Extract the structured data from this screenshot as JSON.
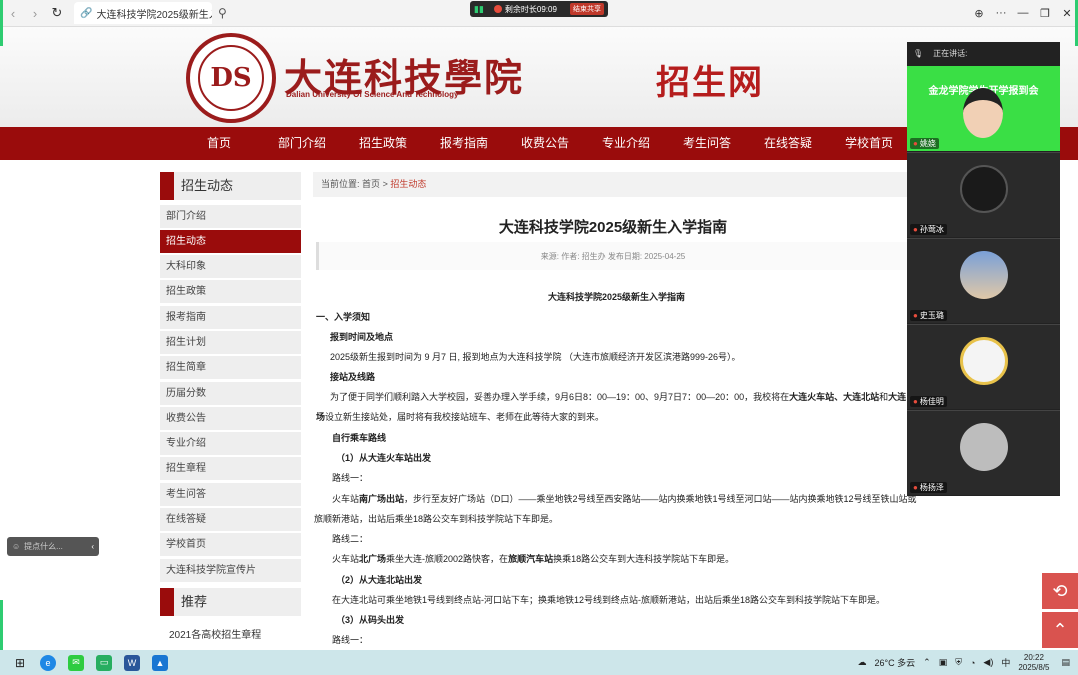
{
  "browser": {
    "tab_title": "大连科技学院2025级新生入学",
    "back_icon": "back-arrow-icon",
    "forward_icon": "forward-arrow-icon",
    "refresh_icon": "refresh-icon"
  },
  "meeting": {
    "remaining": "剩余时长09:09",
    "end_label": "结束共享",
    "speaking_label": "正在讲话:"
  },
  "site": {
    "school_cn": "大连科技學院",
    "school_en": "Dalian University Of Science And Technology",
    "brand": "招生网",
    "nav": [
      "首页",
      "部门介绍",
      "招生政策",
      "报考指南",
      "收费公告",
      "专业介绍",
      "考生问答",
      "在线答疑",
      "学校首页"
    ]
  },
  "sidebar": {
    "title": "招生动态",
    "items": [
      "部门介绍",
      "招生动态",
      "大科印象",
      "招生政策",
      "报考指南",
      "招生计划",
      "招生简章",
      "历届分数",
      "收费公告",
      "专业介绍",
      "招生章程",
      "考生问答",
      "在线答疑",
      "学校首页",
      "大连科技学院宣传片"
    ],
    "active_index": 1,
    "rec_title": "推荐",
    "rec_items": [
      "2021各高校招生章程"
    ]
  },
  "breadcrumb": {
    "prefix": "当前位置:",
    "home": "首页",
    "sep": ">",
    "current": "招生动态"
  },
  "article": {
    "title": "大连科技学院2025级新生入学指南",
    "meta": "来源:  作者:  招生办  发布日期:  2025-04-25",
    "subtitle": "大连科技学院2025级新生入学指南",
    "s1": "一、入学须知",
    "h_report": "报到时间及地点",
    "p_report": "2025级新生报到时间为 9 月7 日,  报到地点为大连科技学院 （大连市旅顺经济开发区滨港路999-26号）。",
    "h_pickup": "接站及线路",
    "p_pickup_1a": "为了便于同学们顺利踏入大学校园，妥善办理入学手续，9月6日8：00—19：00、9月7日7：00—20：00，我校将在",
    "p_pickup_1b": "大连火车站、大连北站",
    "p_pickup_1c": "和",
    "p_pickup_1d": "大连",
    "p_pickup_2a": "场",
    "p_pickup_2b": "设立新生接站处，届时将有我校接站班车、老师在此等待大家的到来。",
    "h_self": "自行乘车路线",
    "h_from_rail": "（1）从大连火车站出发",
    "route1": "路线一：",
    "p_route1a": "火车站",
    "p_route1b": "南广场出站",
    "p_route1c": "，步行至友好广场站（D口）——乘坐地铁2号线至西安路站——站内换乘地铁1号线至河口站——站内换乘地铁12号线至铁山站或",
    "p_route1d": "旅顺新港站，出站后乘坐18路公交车到科技学院站下车即是。",
    "route2": "路线二：",
    "p_route2a": "火车站",
    "p_route2b": "北广场",
    "p_route2c": "乘坐大连-旅顺2002路快客，在",
    "p_route2d": "旅顺汽车站",
    "p_route2e": "换乘18路公交车到大连科技学院站下车即是。",
    "h_from_north": "（2）从大连北站出发",
    "p_north": "在大连北站可乘坐地铁1号线到终点站-河口站下车；换乘地铁12号线到终点站-旅顺新港站，出站后乘坐18路公交车到科技学院站下车即是。",
    "h_from_port": "（3）从码头出发",
    "route3": "路线一："
  },
  "vc": {
    "participants": [
      "姚娆",
      "孙莺冰",
      "史玉璐",
      "杨佳明",
      "杨扬泽"
    ],
    "banner": "金龙学院学生开学报到会"
  },
  "left_tool": {
    "placeholder": "提点什么..."
  },
  "taskbar": {
    "weather": "26°C  多云",
    "time": "20:22",
    "date": "2025/8/5"
  },
  "colors": {
    "brand_red": "#9a0c0c",
    "meeting_green": "#3adf45"
  }
}
